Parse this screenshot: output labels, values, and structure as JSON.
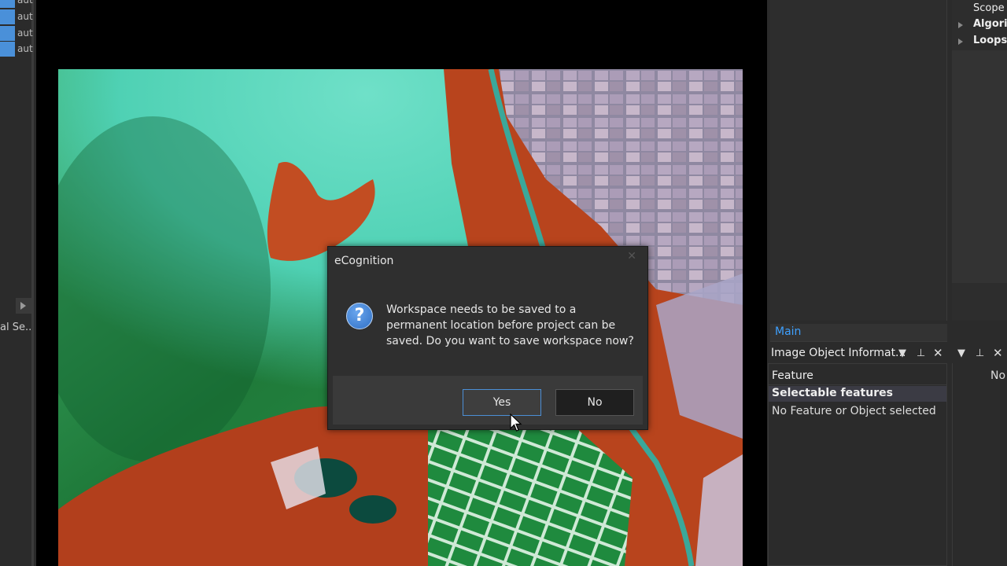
{
  "left_panel": {
    "rows": [
      "aut",
      "aut",
      "aut",
      "aut"
    ],
    "panel_label": "al Se..."
  },
  "right_panel": {
    "tree": {
      "scope_label": "Scope",
      "algorithm_label": "Algorit",
      "loops_label": "Loops"
    },
    "main_tab_label": "Main",
    "image_object": {
      "title": "Image Object Informat...",
      "feature_col": "Feature",
      "selectable_label": "Selectable features",
      "empty_message": "No Feature or Object selected"
    },
    "secondary_panel_text": "No"
  },
  "dialog": {
    "title": "eCognition",
    "close_glyph": "✕",
    "icon": "question-icon",
    "message": "Workspace needs to be saved to a permanent location before project can be saved. Do you want to save workspace now?",
    "yes_label": "Yes",
    "no_label": "No"
  },
  "colors": {
    "accent": "#3ea0ff",
    "selection_blue": "#4a90d9",
    "panel_bg": "#2b2b2b"
  }
}
